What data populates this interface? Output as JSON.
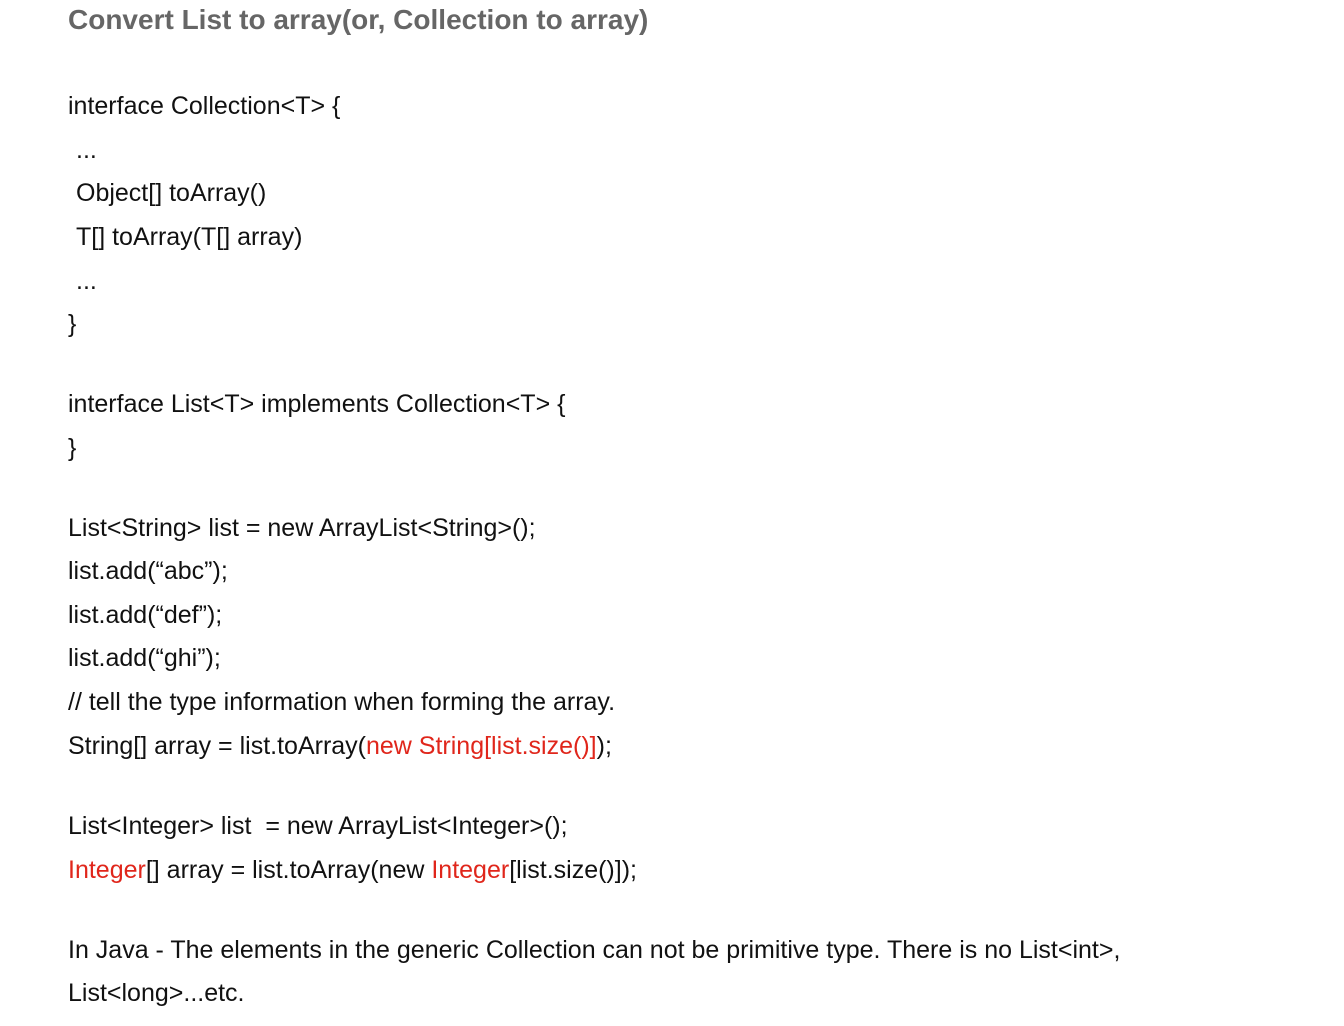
{
  "title": "Convert List to array(or, Collection to array)",
  "colors": {
    "title": "#666666",
    "text": "#111111",
    "highlight": "#e0261b"
  },
  "collection_block": {
    "open": "interface Collection<T> {",
    "ellipsis1": "...",
    "method1": "Object[] toArray()",
    "method2": "T[] toArray(T[] array)",
    "ellipsis2": "...",
    "close": "}"
  },
  "list_block": {
    "open": "interface List<T> implements Collection<T> {",
    "close": "}"
  },
  "string_example": {
    "line1": "List<String> list = new ArrayList<String>();",
    "line2": "list.add(“abc”);",
    "line3": "list.add(“def”);",
    "line4": "list.add(“ghi”);",
    "comment": "// tell the type information when forming the array.",
    "toarray_pre": "String[] array = list.toArray(",
    "toarray_red": "new String[list.size()]",
    "toarray_post": ");"
  },
  "integer_example": {
    "line1": "List<Integer> list  = new ArrayList<Integer>();",
    "red1": "Integer",
    "mid": "[] array = list.toArray(new ",
    "red2": "Integer",
    "post": "[list.size()]);"
  },
  "note": {
    "line1": "In Java - The elements in the generic Collection can not be primitive type. There is no List<int>,",
    "line2": "List<long>...etc."
  }
}
